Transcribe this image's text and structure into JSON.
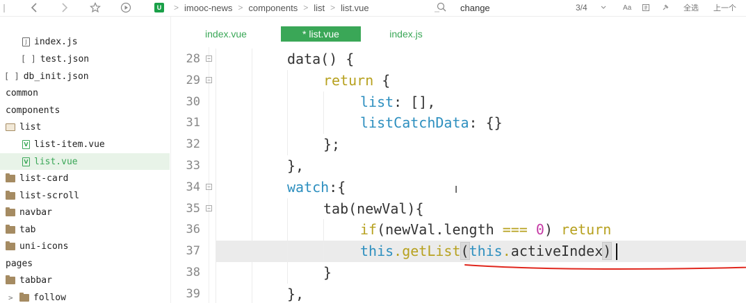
{
  "toolbar": {
    "back_icon": "chevron-left-icon",
    "forward_icon": "chevron-right-icon",
    "star_icon": "star-icon",
    "run_icon": "play-circle-icon",
    "project_icon_label": "U",
    "breadcrumbs": [
      "imooc-news",
      "components",
      "list",
      "list.vue"
    ],
    "search_icon": "search-icon",
    "search_value": "change",
    "match_count": "3/4",
    "match_case_label": "Aa",
    "select_all_label": "全选",
    "prev_label": "上一个",
    "accent": "#3aa757"
  },
  "sidebar": {
    "items": [
      {
        "label": "index.js",
        "kind": "file"
      },
      {
        "label": "test.json",
        "kind": "json"
      },
      {
        "label": "db_init.json",
        "kind": "json"
      },
      {
        "label": "common",
        "kind": "plain"
      },
      {
        "label": "components",
        "kind": "plain"
      },
      {
        "label": "list",
        "kind": "folder-open"
      },
      {
        "label": "list-item.vue",
        "kind": "vue"
      },
      {
        "label": "list.vue",
        "kind": "vue",
        "selected": true
      },
      {
        "label": "list-card",
        "kind": "folder"
      },
      {
        "label": "list-scroll",
        "kind": "folder"
      },
      {
        "label": "navbar",
        "kind": "folder"
      },
      {
        "label": "tab",
        "kind": "folder"
      },
      {
        "label": "uni-icons",
        "kind": "folder"
      },
      {
        "label": "pages",
        "kind": "plain"
      },
      {
        "label": "tabbar",
        "kind": "folder"
      },
      {
        "label": "follow",
        "kind": "folder-collapsed"
      }
    ]
  },
  "tabs": [
    {
      "label": "index.vue",
      "active": false
    },
    {
      "label": "* list.vue",
      "active": true
    },
    {
      "label": "index.js",
      "active": false
    }
  ],
  "code": {
    "current_line": "37",
    "lines": [
      {
        "num": "28",
        "fold": "⊟",
        "tokens": [
          [
            "plain",
            "data() {"
          ]
        ]
      },
      {
        "num": "29",
        "fold": "⊟",
        "tokens": [
          [
            "kw",
            "return"
          ],
          [
            "plain",
            " {"
          ]
        ]
      },
      {
        "num": "30",
        "fold": "",
        "tokens": [
          [
            "prop",
            "list"
          ],
          [
            "punc",
            ": [],"
          ]
        ]
      },
      {
        "num": "31",
        "fold": "",
        "tokens": [
          [
            "prop",
            "listCatchData"
          ],
          [
            "punc",
            ": {}"
          ]
        ]
      },
      {
        "num": "32",
        "fold": "",
        "tokens": [
          [
            "punc",
            "};"
          ]
        ]
      },
      {
        "num": "33",
        "fold": "",
        "tokens": [
          [
            "punc",
            "},"
          ]
        ]
      },
      {
        "num": "34",
        "fold": "⊟",
        "tokens": [
          [
            "prop",
            "watch"
          ],
          [
            "punc",
            ":{"
          ]
        ]
      },
      {
        "num": "35",
        "fold": "⊟",
        "tokens": [
          [
            "plain",
            "tab(newVal){"
          ]
        ]
      },
      {
        "num": "36",
        "fold": "",
        "tokens": [
          [
            "kw",
            "if"
          ],
          [
            "plain",
            "(newVal.length "
          ],
          [
            "kw",
            "==="
          ],
          [
            "plain",
            " "
          ],
          [
            "num",
            "0"
          ],
          [
            "plain",
            ") "
          ],
          [
            "kw",
            "return"
          ]
        ]
      },
      {
        "num": "37",
        "fold": "",
        "tokens": [
          [
            "this",
            "this"
          ],
          [
            "kw",
            "."
          ],
          [
            "kw",
            "getList"
          ],
          [
            "phl",
            "("
          ],
          [
            "this",
            "this"
          ],
          [
            "kw",
            "."
          ],
          [
            "plain",
            "activeIndex"
          ],
          [
            "phl",
            ")"
          ]
        ]
      },
      {
        "num": "38",
        "fold": "",
        "tokens": [
          [
            "punc",
            "}"
          ]
        ]
      },
      {
        "num": "39",
        "fold": "",
        "tokens": [
          [
            "punc",
            "},"
          ]
        ]
      }
    ]
  },
  "annotation_color": "#e0261c"
}
